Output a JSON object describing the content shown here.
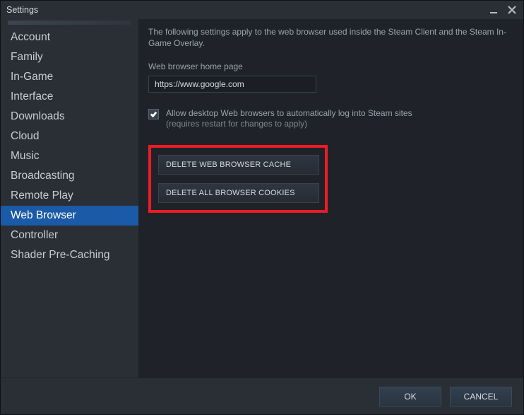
{
  "window": {
    "title": "Settings"
  },
  "sidebar": {
    "items": [
      {
        "label": "Account"
      },
      {
        "label": "Family"
      },
      {
        "label": "In-Game"
      },
      {
        "label": "Interface"
      },
      {
        "label": "Downloads"
      },
      {
        "label": "Cloud"
      },
      {
        "label": "Music"
      },
      {
        "label": "Broadcasting"
      },
      {
        "label": "Remote Play"
      },
      {
        "label": "Web Browser"
      },
      {
        "label": "Controller"
      },
      {
        "label": "Shader Pre-Caching"
      }
    ],
    "active_index": 9
  },
  "content": {
    "intro": "The following settings apply to the web browser used inside the Steam Client and the Steam In-Game Overlay.",
    "homepage_label": "Web browser home page",
    "homepage_value": "https://www.google.com",
    "allow_desktop_login": {
      "label": "Allow desktop Web browsers to automatically log into Steam sites",
      "sub": "(requires restart for changes to apply)",
      "checked": true
    },
    "buttons": {
      "delete_cache": "DELETE WEB BROWSER CACHE",
      "delete_cookies": "DELETE ALL BROWSER COOKIES"
    }
  },
  "footer": {
    "ok": "OK",
    "cancel": "CANCEL"
  }
}
